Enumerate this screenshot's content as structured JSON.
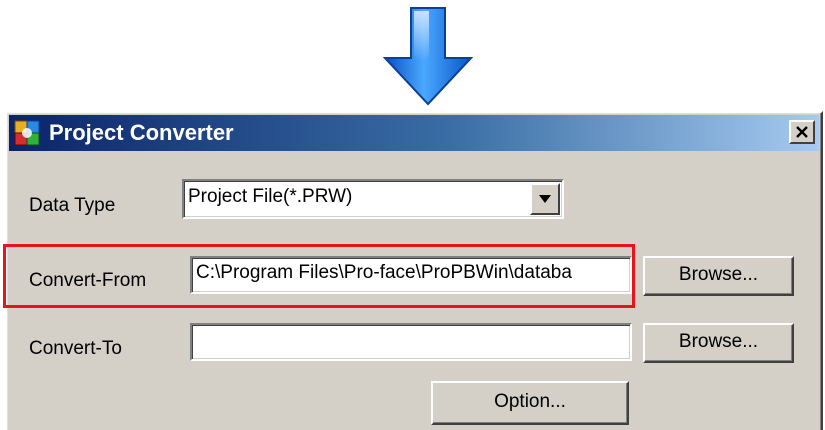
{
  "window": {
    "title": "Project Converter",
    "close_glyph": "✕"
  },
  "fields": {
    "data_type_label": "Data Type",
    "data_type_value": "Project File(*.PRW)",
    "convert_from_label": "Convert-From",
    "convert_from_value": "C:\\Program Files\\Pro-face\\ProPBWin\\databa",
    "convert_to_label": "Convert-To",
    "convert_to_value": ""
  },
  "buttons": {
    "browse_from": "Browse...",
    "browse_to": "Browse...",
    "option": "Option..."
  },
  "colors": {
    "arrow": "#1e78e6",
    "highlight": "#e8141c",
    "title_bar": "#0a246a"
  },
  "icons": {
    "arrow": "down-arrow-icon",
    "app": "project-converter-icon",
    "close": "close-icon",
    "dropdown": "triangle-down-icon"
  }
}
